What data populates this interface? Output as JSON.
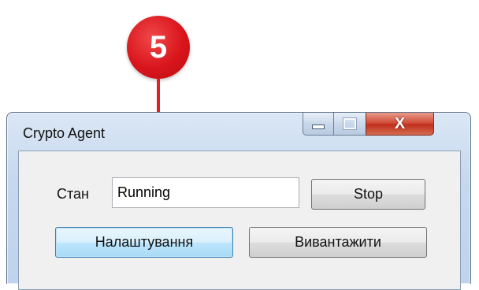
{
  "callout": {
    "number": "5",
    "color": "#e41f26"
  },
  "window": {
    "title": "Crypto Agent",
    "controls": {
      "minimize": "minimize-icon",
      "maximize": "maximize-icon",
      "close": "X"
    }
  },
  "form": {
    "state_label": "Стан",
    "state_value": "Running",
    "stop_label": "Stop",
    "settings_label": "Налаштування",
    "unload_label": "Вивантажити"
  }
}
